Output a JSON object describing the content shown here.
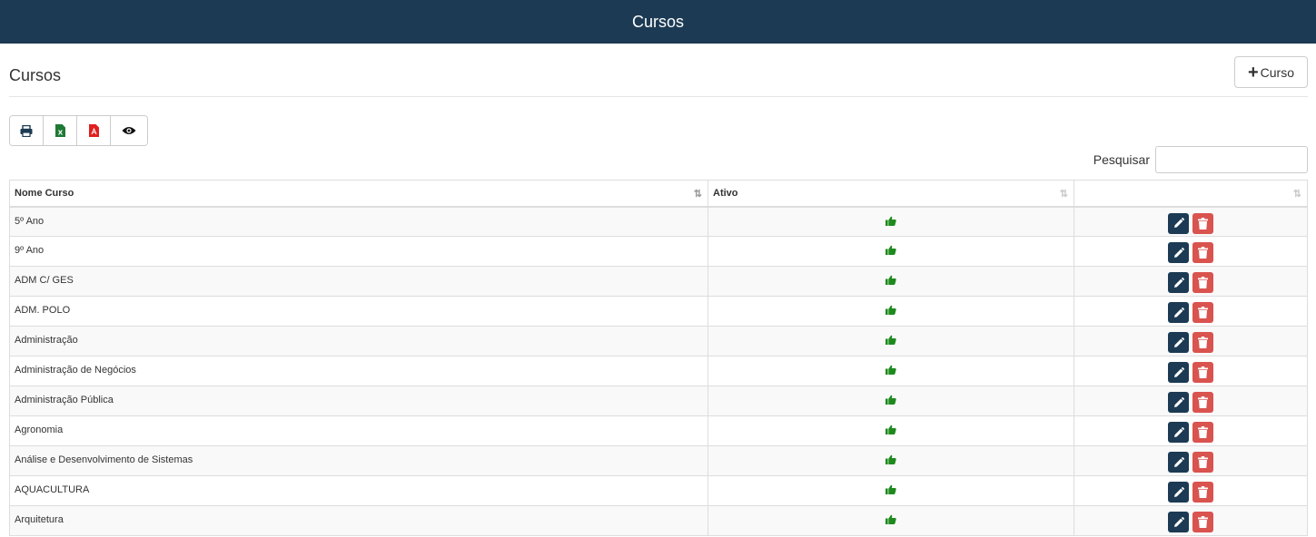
{
  "header": {
    "title": "Cursos"
  },
  "page": {
    "title": "Cursos",
    "add_button": "Curso"
  },
  "toolbar": {
    "icons": [
      "print-icon",
      "excel-icon",
      "pdf-icon",
      "eye-icon"
    ]
  },
  "search": {
    "label": "Pesquisar",
    "value": ""
  },
  "table": {
    "columns": [
      "Nome Curso",
      "Ativo",
      ""
    ],
    "rows": [
      {
        "name": "5º Ano",
        "active": true
      },
      {
        "name": "9º Ano",
        "active": true
      },
      {
        "name": "ADM C/ GES",
        "active": true
      },
      {
        "name": "ADM. POLO",
        "active": true
      },
      {
        "name": "Administração",
        "active": true
      },
      {
        "name": "Administração de Negócios",
        "active": true
      },
      {
        "name": "Administração Pública",
        "active": true
      },
      {
        "name": "Agronomia",
        "active": true
      },
      {
        "name": "Análise e Desenvolvimento de Sistemas",
        "active": true
      },
      {
        "name": "AQUACULTURA",
        "active": true
      },
      {
        "name": "Arquitetura",
        "active": true
      }
    ]
  },
  "colors": {
    "header_bg": "#1c3a53",
    "edit": "#1c3a53",
    "delete": "#d9534f",
    "active_icon": "#1e8a1e",
    "excel": "#1d7a35",
    "pdf": "#e02020"
  }
}
